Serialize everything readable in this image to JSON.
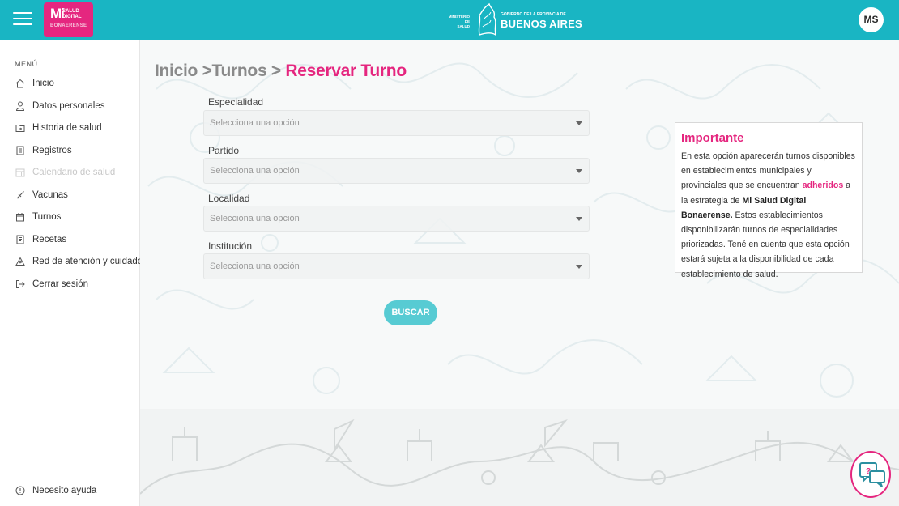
{
  "header": {
    "logo": {
      "mi": "Mi",
      "salud": "SALUD",
      "digital": "DIGITAL",
      "bonaerense": "BONAERENSE"
    },
    "gov": {
      "ministerio": "MINISTERIO DE",
      "salud": "SALUD",
      "gobierno": "GOBIERNO DE LA PROVINCIA DE",
      "buenos_aires": "BUENOS AIRES"
    },
    "avatar_initials": "MS",
    "color": "#19b5c3"
  },
  "sidebar": {
    "menu_title": "MENÚ",
    "items": [
      {
        "label": "Inicio",
        "icon": "home-icon",
        "disabled": false
      },
      {
        "label": "Datos personales",
        "icon": "user-icon",
        "disabled": false
      },
      {
        "label": "Historia de salud",
        "icon": "folder-icon",
        "disabled": false
      },
      {
        "label": "Registros",
        "icon": "document-icon",
        "disabled": false
      },
      {
        "label": "Calendario de salud",
        "icon": "calendar-grid-icon",
        "disabled": true
      },
      {
        "label": "Vacunas",
        "icon": "syringe-icon",
        "disabled": false
      },
      {
        "label": "Turnos",
        "icon": "calendar-icon",
        "disabled": false
      },
      {
        "label": "Recetas",
        "icon": "prescription-icon",
        "disabled": false
      },
      {
        "label": "Red de atención y cuidados",
        "icon": "network-icon",
        "disabled": false
      },
      {
        "label": "Cerrar sesión",
        "icon": "logout-icon",
        "disabled": false
      }
    ],
    "help": {
      "label": "Necesito ayuda",
      "icon": "help-circle-icon"
    }
  },
  "main": {
    "breadcrumb": {
      "part1": "Inicio >Turnos > ",
      "part2": "Reservar Turno"
    },
    "fields": [
      {
        "label": "Especialidad",
        "placeholder": "Selecciona una opción"
      },
      {
        "label": "Partido",
        "placeholder": "Selecciona una opción"
      },
      {
        "label": "Localidad",
        "placeholder": "Selecciona una opción"
      },
      {
        "label": "Institución",
        "placeholder": "Selecciona una opción"
      }
    ],
    "search_button": "BUSCAR",
    "info_box": {
      "title": "Importante",
      "text1": "En esta opción aparecerán turnos disponibles en establecimientos municipales y provinciales que se encuentran ",
      "highlight": "adheridos",
      "text2": " a la estrategia de ",
      "bold": "Mi Salud Digital Bonaerense.",
      "text3": " Estos establecimientos disponibilizarán turnos de especialidades priorizadas. Tené en cuenta que esta opción estará sujeta a la disponibilidad de cada establecimiento de salud."
    }
  },
  "colors": {
    "accent": "#e5267f",
    "primary": "#19b5c3",
    "button": "#57cbd3"
  }
}
